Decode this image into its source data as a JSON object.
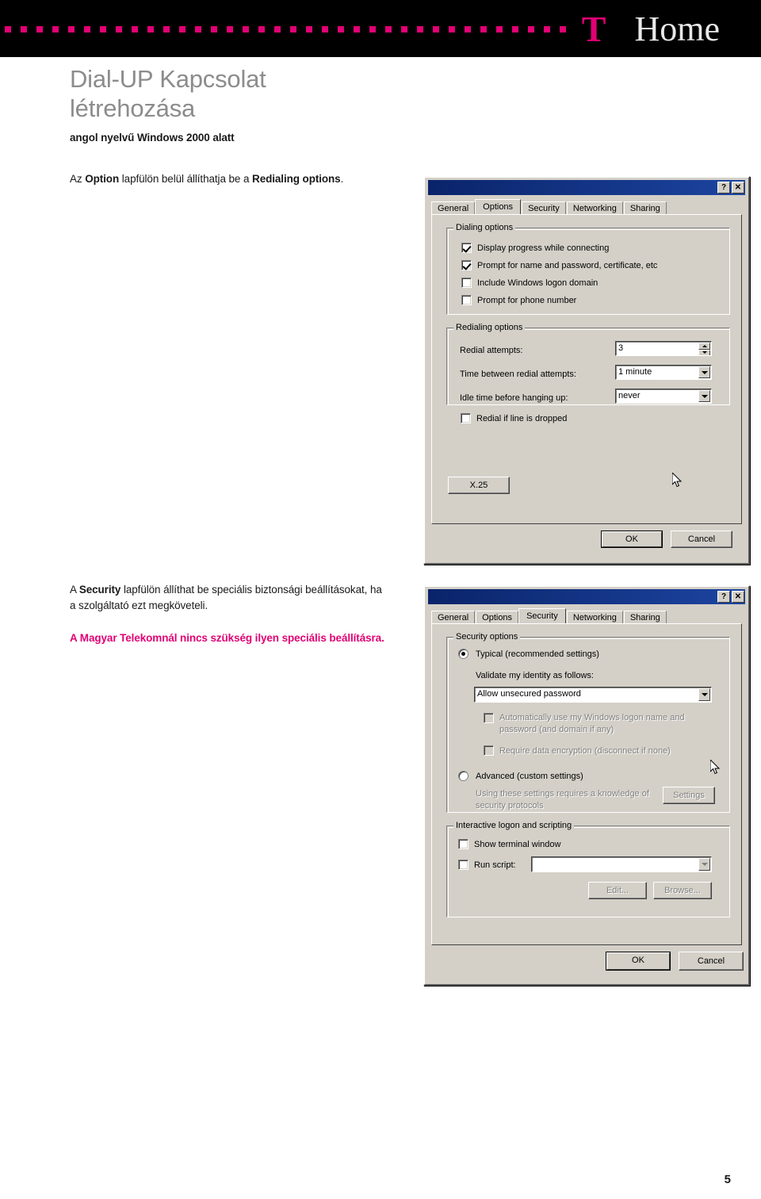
{
  "header": {
    "logo_t": "T",
    "logo_home": "Home",
    "dot_count_left": 46,
    "accent_color": "#e20074",
    "bar_color": "#000000"
  },
  "document": {
    "title_line1": "Dial-UP Kapcsolat",
    "title_line2": "létrehozása",
    "subtitle": "angol nyelvű Windows 2000 alatt",
    "title_color": "#8c8c8c",
    "page_number": "5"
  },
  "paragraphs": {
    "p1_pre": "Az ",
    "p1_bold1": "Option",
    "p1_mid": " lapfülön belül állíthatja be a ",
    "p1_bold2": "Redialing options",
    "p1_end": ".",
    "p2_pre": "A ",
    "p2_bold": "Security",
    "p2_rest": " lapfülön állíthat be speciális biztonsági beállításokat, ha a szolgáltató ezt megköveteli.",
    "p3": "A Magyar Telekomnál nincs szükség ilyen speciális beállításra."
  },
  "dialog_options": {
    "titlebar_help": "?",
    "titlebar_close": "✕",
    "tabs": [
      {
        "label": "General",
        "active": false
      },
      {
        "label": "Options",
        "active": true
      },
      {
        "label": "Security",
        "active": false
      },
      {
        "label": "Networking",
        "active": false
      },
      {
        "label": "Sharing",
        "active": false
      }
    ],
    "dialing_group": "Dialing options",
    "dialing_items": [
      {
        "label": "Display progress while connecting",
        "checked": true
      },
      {
        "label": "Prompt for name and password, certificate, etc",
        "checked": true
      },
      {
        "label": "Include Windows logon domain",
        "checked": false
      },
      {
        "label": "Prompt for phone number",
        "checked": false
      }
    ],
    "redialing_group": "Redialing options",
    "redial_attempts_label": "Redial attempts:",
    "redial_attempts_value": "3",
    "time_between_label": "Time between redial attempts:",
    "time_between_value": "1 minute",
    "idle_time_label": "Idle time before hanging up:",
    "idle_time_value": "never",
    "redial_dropped_label": "Redial if line is dropped",
    "redial_dropped_checked": false,
    "x25_button": "X.25",
    "ok_button": "OK",
    "cancel_button": "Cancel"
  },
  "dialog_security": {
    "titlebar_help": "?",
    "titlebar_close": "✕",
    "tabs": [
      {
        "label": "General",
        "active": false
      },
      {
        "label": "Options",
        "active": false
      },
      {
        "label": "Security",
        "active": true
      },
      {
        "label": "Networking",
        "active": false
      },
      {
        "label": "Sharing",
        "active": false
      }
    ],
    "security_group": "Security options",
    "typical_radio": "Typical (recommended settings)",
    "typical_selected": true,
    "validate_label": "Validate my identity as follows:",
    "validate_value": "Allow unsecured password",
    "auto_logon_label": "Automatically use my Windows logon name and password (and domain if any)",
    "auto_logon_checked": false,
    "auto_logon_disabled": true,
    "require_encryption_label": "Require data encryption (disconnect if none)",
    "require_encryption_checked": false,
    "require_encryption_disabled": true,
    "advanced_radio": "Advanced (custom settings)",
    "advanced_selected": false,
    "advanced_hint": "Using these settings requires a knowledge of security protocols",
    "settings_button": "Settings",
    "settings_disabled": true,
    "interactive_group": "Interactive logon and scripting",
    "show_terminal_label": "Show terminal window",
    "show_terminal_checked": false,
    "run_script_label": "Run script:",
    "run_script_checked": false,
    "run_script_value": "",
    "edit_button": "Edit...",
    "browse_button": "Browse...",
    "edit_disabled": true,
    "browse_disabled": true,
    "ok_button": "OK",
    "cancel_button": "Cancel"
  }
}
